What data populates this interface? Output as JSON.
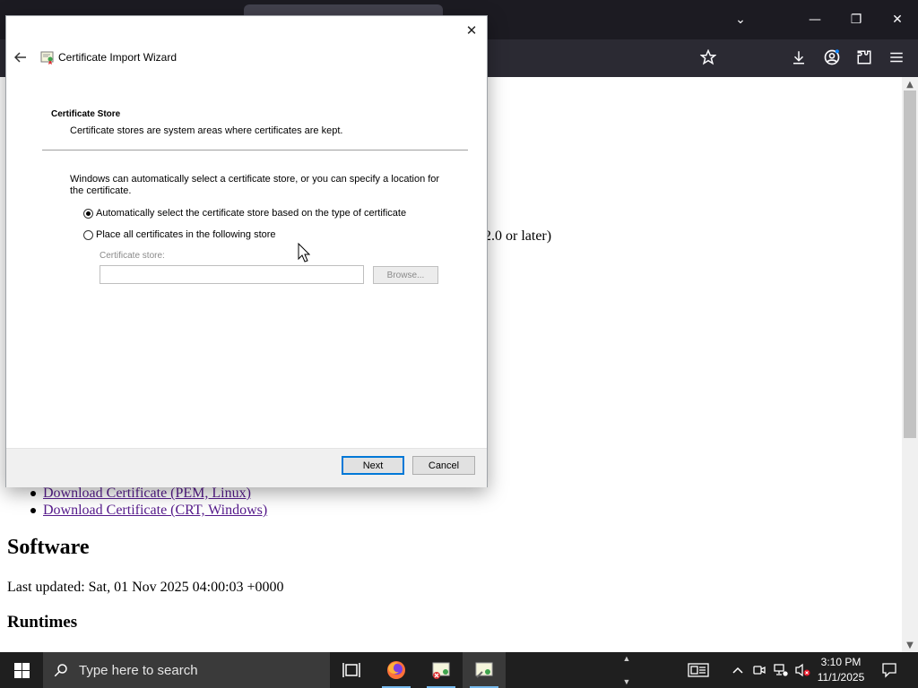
{
  "browser": {
    "window_controls": {
      "minimize": "—",
      "restore": "❐",
      "close": "✕"
    },
    "toolbar_icons": [
      "star-icon",
      "download-icon",
      "account-icon",
      "extensions-icon",
      "menu-icon"
    ]
  },
  "page": {
    "visible_fragment": "2.0 or later)",
    "cert_links": [
      "Download Certificate (PEM, Linux)",
      "Download Certificate (CRT, Windows)"
    ],
    "software_heading": "Software",
    "last_updated": "Last updated: Sat, 01 Nov 2025 04:00:03 +0000",
    "runtimes_heading": "Runtimes"
  },
  "dialog": {
    "title": "Certificate Import Wizard",
    "heading": "Certificate Store",
    "subheading": "Certificate stores are system areas where certificates are kept.",
    "description": "Windows can automatically select a certificate store, or you can specify a location for the certificate.",
    "option_auto": "Automatically select the certificate store based on the type of certificate",
    "option_manual": "Place all certificates in the following store",
    "selected_option": "auto",
    "store_label": "Certificate store:",
    "store_value": "",
    "browse_label": "Browse...",
    "next_label": "Next",
    "cancel_label": "Cancel"
  },
  "taskbar": {
    "search_placeholder": "Type here to search",
    "time": "3:10 PM",
    "date": "11/1/2025",
    "apps": [
      "task-view",
      "firefox",
      "certificate-manager",
      "certificate-import"
    ]
  }
}
